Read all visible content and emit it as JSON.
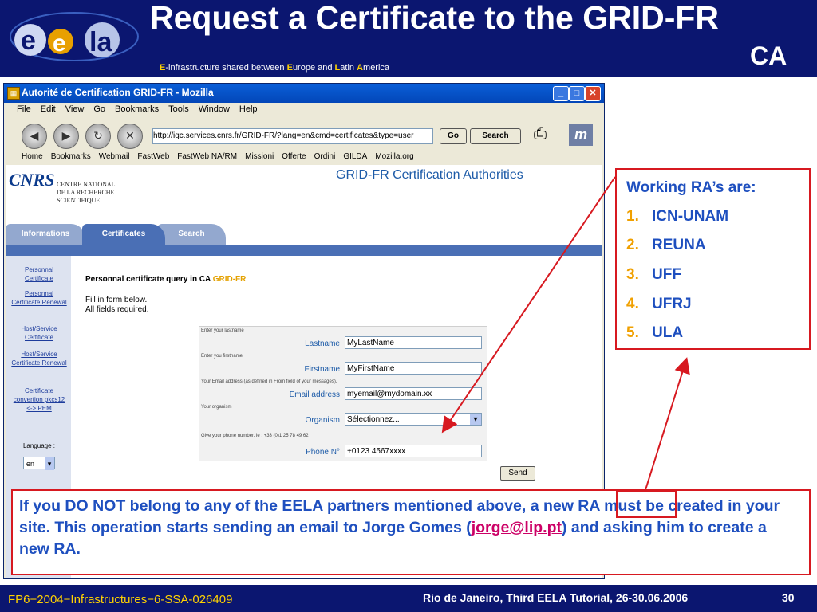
{
  "header": {
    "title": "Request a Certificate to the GRID-FR",
    "title_line2": "CA",
    "subtitle_parts": [
      "E",
      "-infrastructure shared between ",
      "E",
      "urope and ",
      "L",
      "atin ",
      "A",
      "merica"
    ],
    "logo_text": "eela"
  },
  "browser": {
    "window_title": "Autorité de Certification GRID-FR - Mozilla",
    "menu": [
      "File",
      "Edit",
      "View",
      "Go",
      "Bookmarks",
      "Tools",
      "Window",
      "Help"
    ],
    "url": "http://igc.services.cnrs.fr/GRID-FR/?lang=en&cmd=certificates&type=user",
    "go_label": "Go",
    "search_label": "Search",
    "bookmarks": [
      "Home",
      "Bookmarks",
      "Webmail",
      "FastWeb",
      "FastWeb NA/RM",
      "Missioni",
      "Offerte",
      "Ordini",
      "GILDA",
      "Mozilla.org"
    ]
  },
  "site": {
    "cnrs_logo": "CNRS",
    "cnrs_name": [
      "CENTRE NATIONAL",
      "DE LA RECHERCHE",
      "SCIENTIFIQUE"
    ],
    "title": "GRID-FR Certification Authorities",
    "tabs": [
      "Informations",
      "Certificates",
      "Search"
    ],
    "sidebar_links": [
      "Personnal Certificate",
      "Personnal Certificate Renewal",
      "Host/Service Certificate",
      "Host/Service Certificate Renewal",
      "Certificate convertion pkcs12 <-> PEM"
    ],
    "language_label": "Language :",
    "language_value": "en",
    "form_heading": "Personnal certificate  query in CA ",
    "form_heading_ca": "GRID-FR",
    "form_intro_1": "Fill in form below.",
    "form_intro_2": "All fields required.",
    "fields": [
      {
        "hint": "Enter your lastname",
        "label": "Lastname",
        "value": "MyLastName"
      },
      {
        "hint": "Enter you firstname",
        "label": "Firstname",
        "value": "MyFirstName"
      },
      {
        "hint": "Your Email address (as defined in From field of your messages).",
        "label": "Email address",
        "value": "myemail@mydomain.xx"
      },
      {
        "hint": "Your organism",
        "label": "Organism",
        "value": "Sélectionnez..."
      },
      {
        "hint": "Give your phone number, ie : +33 (0)1 25 78 49 62",
        "label": "Phone N°",
        "value": "+0123 4567xxxx"
      }
    ],
    "send_label": "Send"
  },
  "ra_box": {
    "title": "Working RA’s are:",
    "items": [
      "ICN-UNAM",
      "REUNA",
      "UFF",
      "UFRJ",
      "ULA"
    ],
    "numbers": [
      "1.",
      "2.",
      "3.",
      "4.",
      "5."
    ]
  },
  "note": {
    "part1": "If you ",
    "part2": "DO NOT",
    "part3": " belong to any of the EELA partners mentioned ",
    "part4": "above",
    "part5": ", a new RA must be created in your site. This operation starts sending an email to Jorge Gomes (",
    "email": "jorge@lip.pt",
    "part6": ") and asking him to create a new RA."
  },
  "footer": {
    "left": "FP6−2004−Infrastructures−6-SSA-026409",
    "right": "Rio de Janeiro, Third EELA Tutorial, 26-30.06.2006",
    "page": "30"
  },
  "colors": {
    "header_bg": "#0b1670",
    "accent_red": "#d71920",
    "text_blue": "#1e4fbf",
    "number_orange": "#f0a000"
  }
}
